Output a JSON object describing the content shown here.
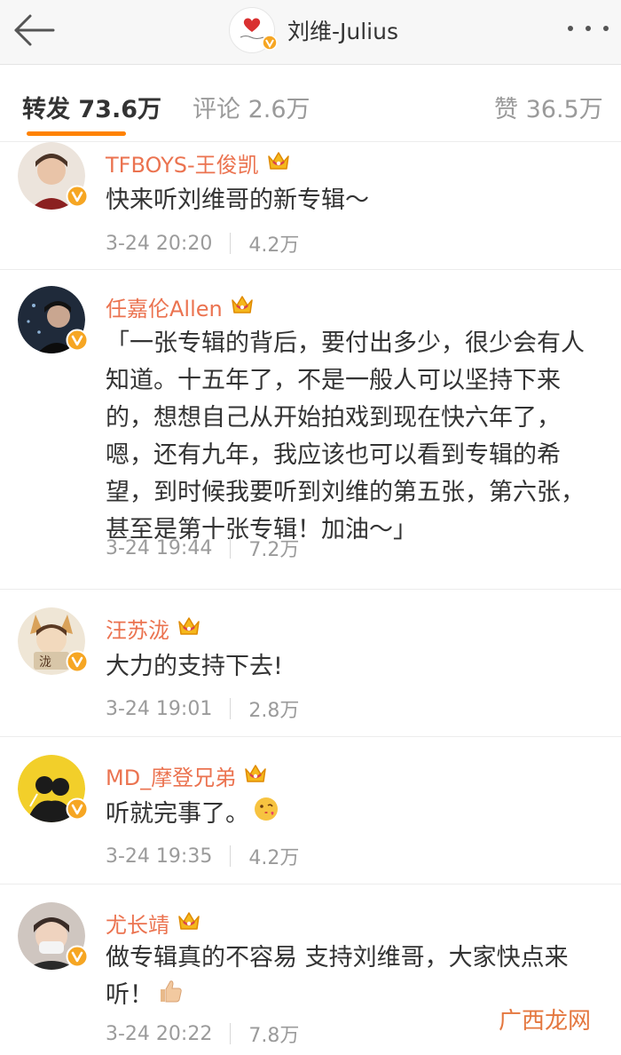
{
  "header": {
    "title": "刘维-Julius",
    "back_icon": "back-arrow-icon",
    "more_icon": "more-dots-icon"
  },
  "tabs": [
    {
      "label": "转发 73.6万",
      "active": true
    },
    {
      "label": "评论 2.6万",
      "active": false
    },
    {
      "label": "赞 36.5万",
      "active": false
    }
  ],
  "comments": [
    {
      "name": "TFBOYS-王俊凯",
      "text": "快来听刘维哥的新专辑～",
      "time": "3-24 20:20",
      "count": "4.2万",
      "avatar_color": "#8a6a58"
    },
    {
      "name": "任嘉伦Allen",
      "text": "「一张专辑的背后，要付出多少，很少会有人知道。十五年了，不是一般人可以坚持下来的，想想自己从开始拍戏到现在快六年了，嗯，还有九年，我应该也可以看到专辑的希望，到时候我要听到刘维的第五张，第六张，甚至是第十张专辑！加油～」",
      "time": "3-24 19:44",
      "count": "7.2万",
      "avatar_color": "#1f2a3a"
    },
    {
      "name": "汪苏泷",
      "text": "大力的支持下去!",
      "time": "3-24 19:01",
      "count": "2.8万",
      "avatar_color": "#e8dcc6"
    },
    {
      "name": "MD_摩登兄弟",
      "text": "听就完事了。",
      "time": "3-24 19:35",
      "count": "4.2万",
      "avatar_color": "#f2cf2a"
    },
    {
      "name": "尤长靖",
      "text": "做专辑真的不容易 支持刘维哥，大家快点来听！",
      "time": "3-24 20:22",
      "count": "7.8万",
      "avatar_color": "#cfc6c0"
    }
  ],
  "watermark": "广西龙网",
  "colors": {
    "accent": "#ff8200",
    "username": "#eb7350",
    "verified": "#f6a623"
  }
}
